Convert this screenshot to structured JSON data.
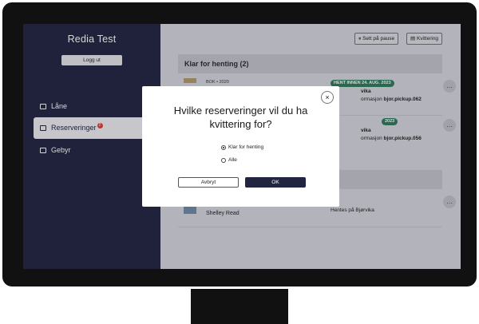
{
  "app": {
    "title": "Redia Test",
    "logout_label": "Logg ut"
  },
  "sidebar": {
    "items": [
      {
        "label": "Låne",
        "icon": "book-icon"
      },
      {
        "label": "Reserveringer",
        "icon": "reservation-icon",
        "badge": "2"
      },
      {
        "label": "Gebyr",
        "icon": "card-icon"
      }
    ]
  },
  "toolbar": {
    "pause_label": "Sett på pause",
    "receipt_label": "Kvittering"
  },
  "section": {
    "title": "Klar for henting (2)"
  },
  "rows": [
    {
      "meta": "BOK • 2020",
      "pill": "HENT INNEN 24. AUG. 2023",
      "line1": "vika",
      "line2_prefix": "ormasjon",
      "line2_code": "bjor.pickup.062",
      "more": "…"
    },
    {
      "pill": "2023",
      "line1": "vika",
      "line2_prefix": "ormasjon",
      "line2_code": "bjor.pickup.056",
      "more": "…"
    },
    {
      "author": "Shelley Read",
      "line1": "Hentes på Bjørvika",
      "more": "…"
    }
  ],
  "modal": {
    "title": "Hvilke reserveringer vil du ha kvittering for?",
    "options": [
      "Klar for henting",
      "Alle"
    ],
    "selected": "Klar for henting",
    "cancel_label": "Avbryt",
    "ok_label": "OK",
    "close": "×"
  },
  "colors": {
    "sidebar": "#222541",
    "pill": "#2f7a5b",
    "badge": "#d9403a"
  }
}
